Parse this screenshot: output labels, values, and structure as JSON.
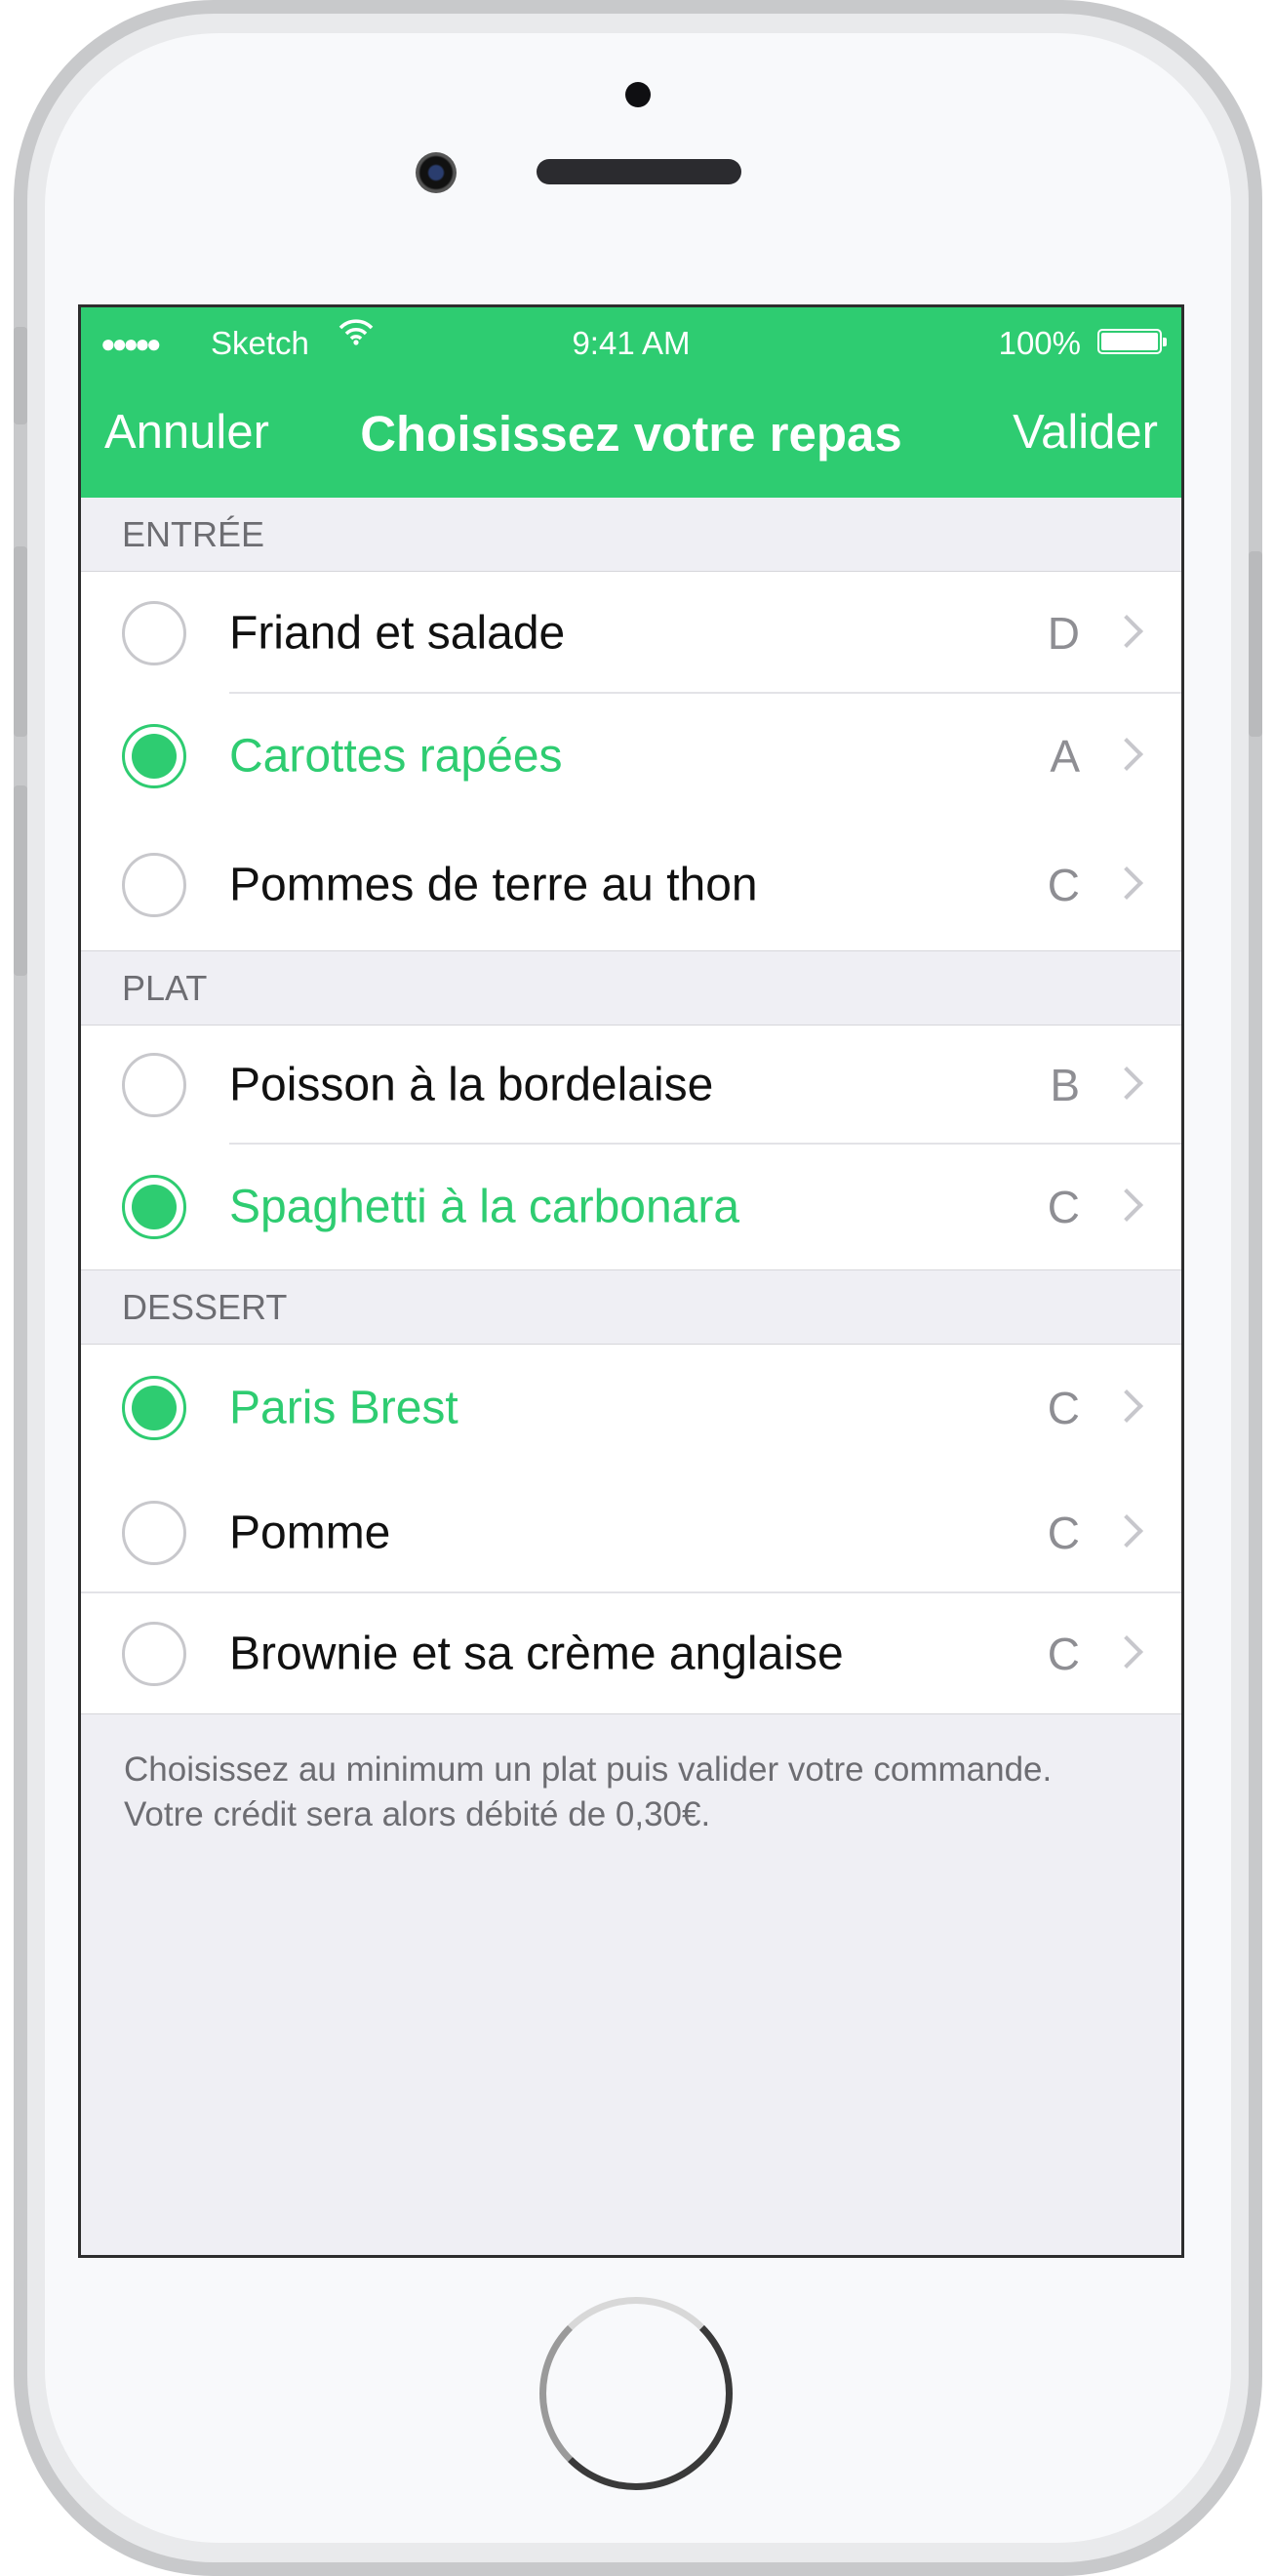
{
  "status_bar": {
    "signal": "●●●●●",
    "carrier": "Sketch",
    "wifi_icon": "wifi-icon",
    "time": "9:41 AM",
    "battery": "100%"
  },
  "nav": {
    "left": "Annuler",
    "title": "Choisissez votre repas",
    "right": "Valider"
  },
  "accent": "#2ecc71",
  "sections": [
    {
      "header": "ENTRÉE",
      "items": [
        {
          "label": "Friand et salade",
          "grade": "D",
          "selected": false
        },
        {
          "label": "Carottes rapées",
          "grade": "A",
          "selected": true
        },
        {
          "label": "Pommes de terre au thon",
          "grade": "C",
          "selected": false
        }
      ]
    },
    {
      "header": "PLAT",
      "items": [
        {
          "label": "Poisson à la bordelaise",
          "grade": "B",
          "selected": false
        },
        {
          "label": "Spaghetti à la carbonara",
          "grade": "C",
          "selected": true
        }
      ]
    },
    {
      "header": "DESSERT",
      "items": [
        {
          "label": "Paris Brest",
          "grade": "C",
          "selected": true
        },
        {
          "label": "Pomme",
          "grade": "C",
          "selected": false
        },
        {
          "label": "Brownie et sa crème anglaise",
          "grade": "C",
          "selected": false
        }
      ]
    }
  ],
  "footer": "Choisissez au minimum un plat puis valider votre commande. Votre crédit sera alors débité de 0,30€."
}
